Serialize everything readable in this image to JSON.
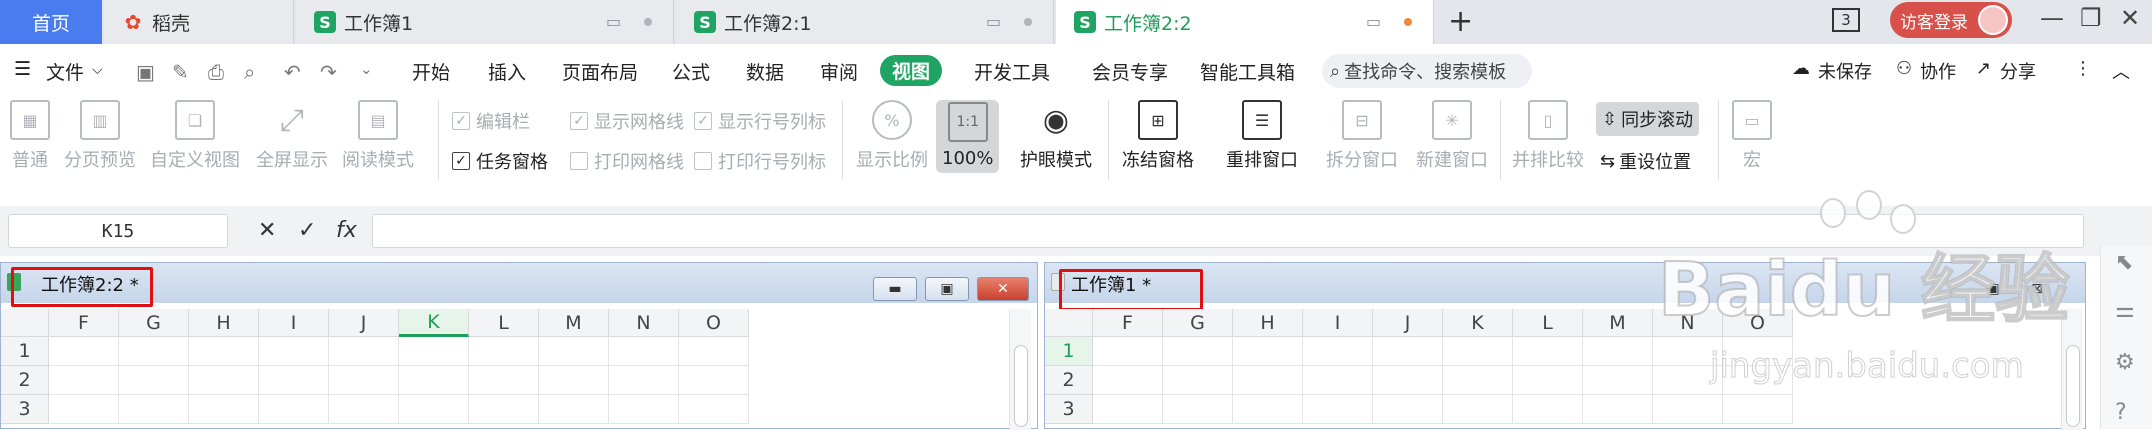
{
  "tabs": {
    "home": "首页",
    "daoke": "稻壳",
    "book1": "工作簿1",
    "book21": "工作簿2:1",
    "book22": "工作簿2:2"
  },
  "titlebar": {
    "window_count": "3",
    "login": "访客登录"
  },
  "menu": {
    "file": "文件",
    "items": [
      "开始",
      "插入",
      "页面布局",
      "公式",
      "数据",
      "审阅",
      "视图",
      "开发工具",
      "会员专享",
      "智能工具箱"
    ],
    "search": "查找命令、搜索模板",
    "unsaved": "未保存",
    "collab": "协作",
    "share": "分享"
  },
  "toolbar": {
    "normal": "普通",
    "page_preview": "分页预览",
    "custom_view": "自定义视图",
    "fullscreen": "全屏显示",
    "read_mode": "阅读模式",
    "edit_bar": "编辑栏",
    "task_pane": "任务窗格",
    "show_grid": "显示网格线",
    "print_grid": "打印网格线",
    "show_headers": "显示行号列标",
    "print_headers": "打印行号列标",
    "zoom_ratio": "显示比例",
    "zoom_icon": "1:1",
    "zoom_100": "100%",
    "eye_mode": "护眼模式",
    "freeze": "冻结窗格",
    "arrange": "重排窗口",
    "split": "拆分窗口",
    "new_window": "新建窗口",
    "side_by_side": "并排比较",
    "sync_scroll": "同步滚动",
    "reset_pos": "重设位置",
    "macro": "宏"
  },
  "formula": {
    "cell_ref": "K15",
    "fx": "fx"
  },
  "left_pane": {
    "title": "工作簿2:2 *",
    "columns": [
      "F",
      "G",
      "H",
      "I",
      "J",
      "K",
      "L",
      "M",
      "N",
      "O"
    ],
    "selected_col": "K",
    "rows": [
      "1",
      "2",
      "3"
    ]
  },
  "right_pane": {
    "title": "工作簿1 *",
    "columns": [
      "F",
      "G",
      "H",
      "I",
      "J",
      "K",
      "L",
      "M",
      "N",
      "O"
    ],
    "rows": [
      "1",
      "2",
      "3"
    ],
    "selected_row": "1"
  },
  "watermark": {
    "brand": "Baidu 经验",
    "url": "jingyan.baidu.com"
  },
  "colors": {
    "accent_green": "#1fa463",
    "home_blue": "#4a7cf0",
    "highlight_red": "#e01010"
  }
}
